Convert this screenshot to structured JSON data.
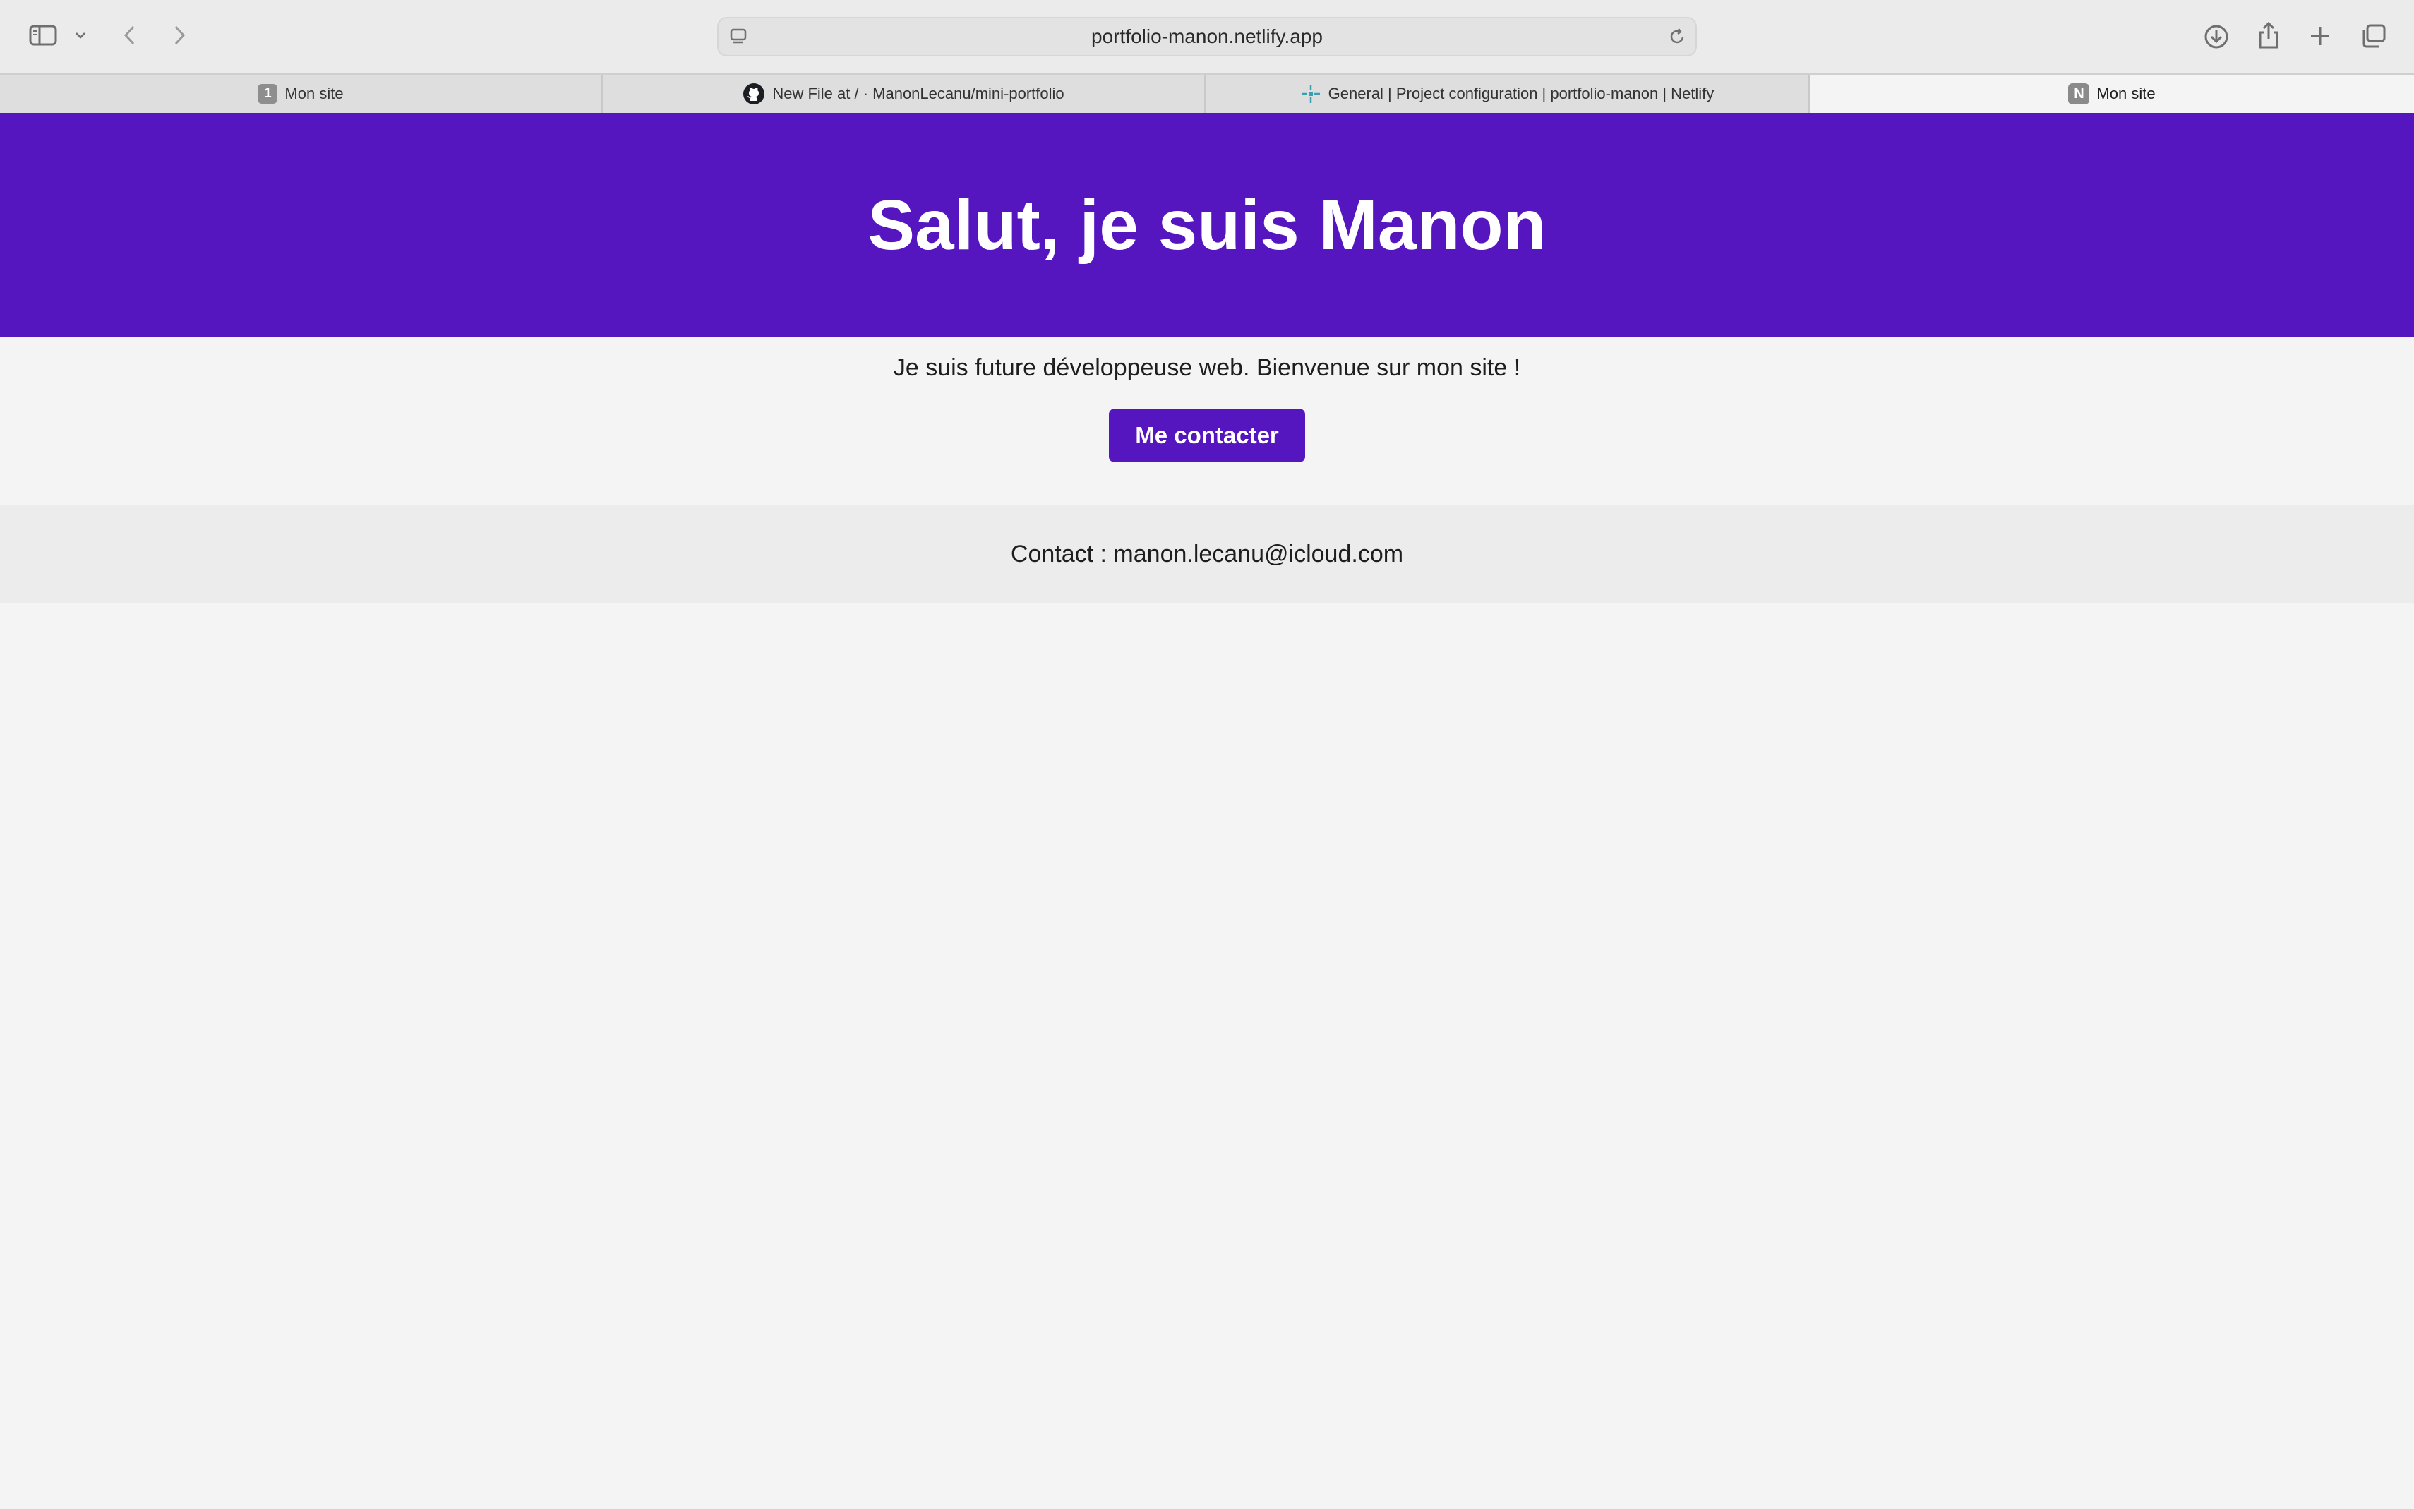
{
  "browser": {
    "url": "portfolio-manon.netlify.app",
    "tabs": [
      {
        "label": "Mon site",
        "favicon": "1"
      },
      {
        "label": "New File at / · ManonLecanu/mini-portfolio",
        "favicon": "github-icon"
      },
      {
        "label": "General | Project configuration | portfolio-manon | Netlify",
        "favicon": "netlify-icon"
      },
      {
        "label": "Mon site",
        "favicon": "N"
      }
    ],
    "active_tab": 3
  },
  "page": {
    "hero_title": "Salut, je suis Manon",
    "intro": "Je suis future développeuse web. Bienvenue sur mon site !",
    "contact_button": "Me contacter",
    "footer_contact": "Contact : manon.lecanu@icloud.com"
  },
  "colors": {
    "brand": "#5516bf",
    "background": "#f4f4f4",
    "footer_background": "#ececec"
  }
}
